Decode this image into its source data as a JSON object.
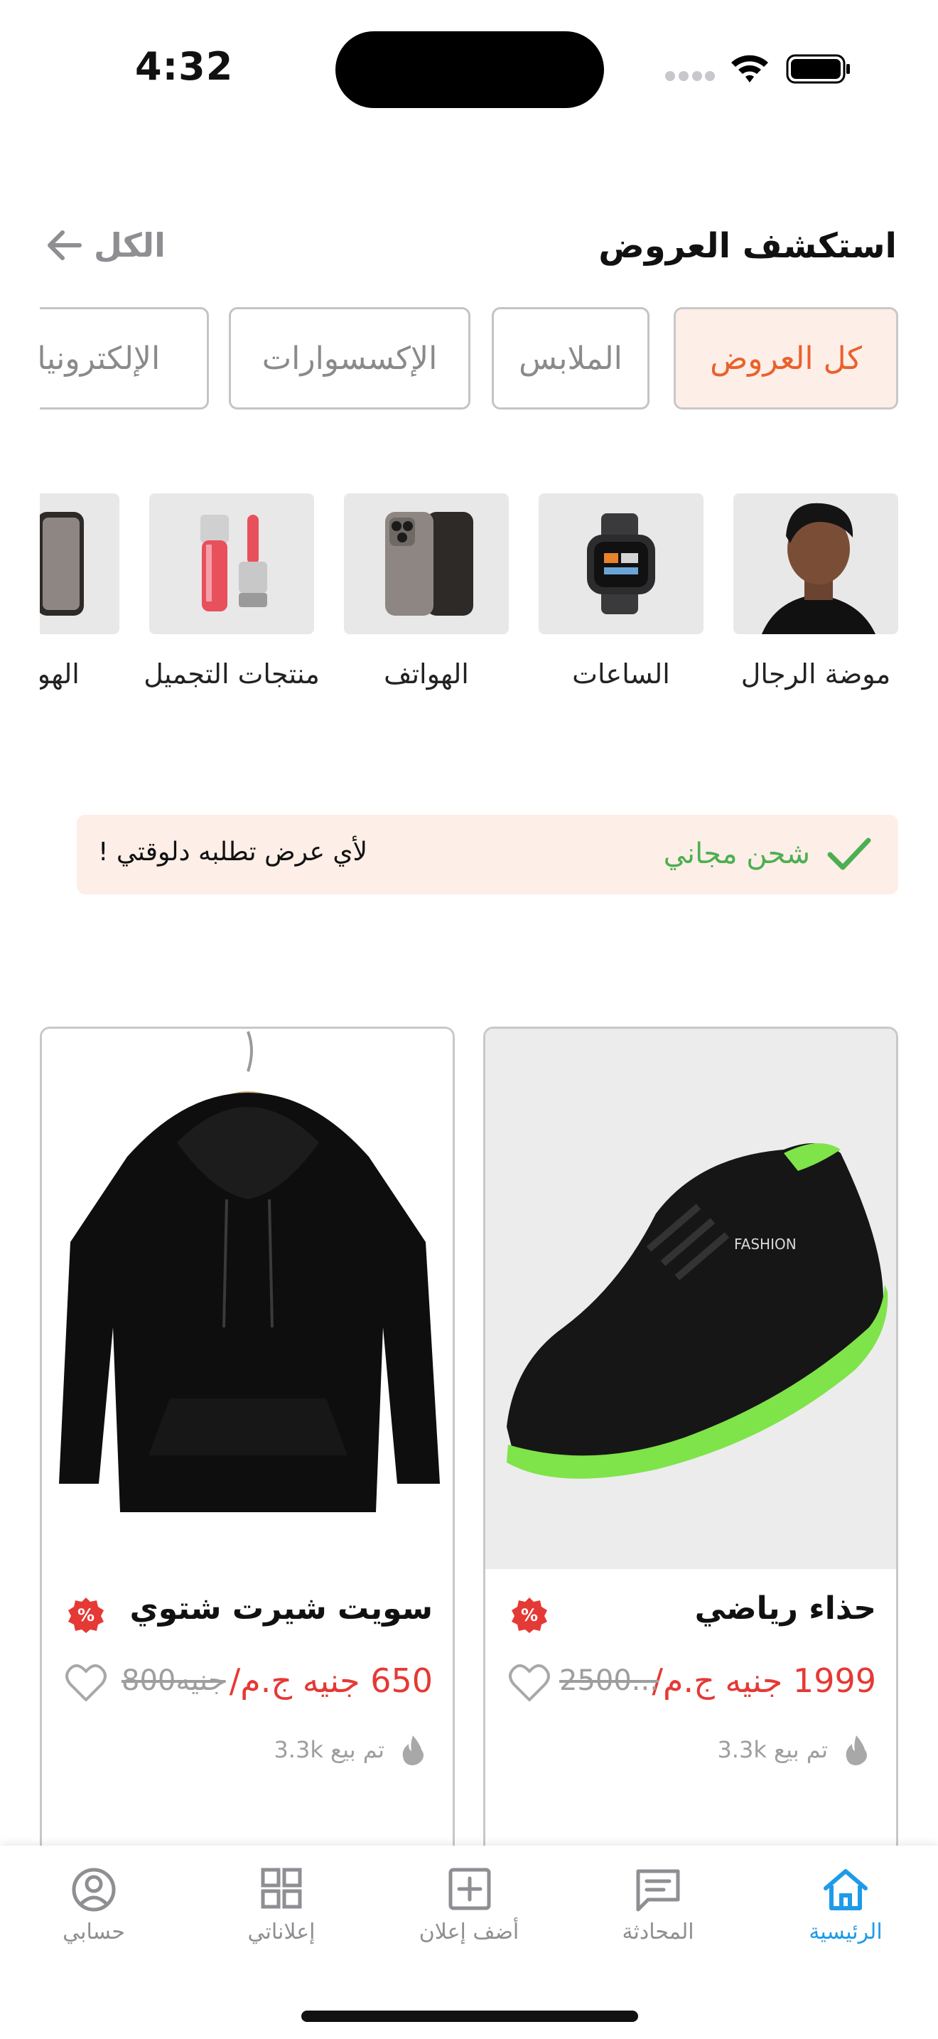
{
  "status_bar": {
    "time": "4:32"
  },
  "header": {
    "title": "استكشف العروض",
    "see_all": "الكل"
  },
  "tabs": [
    {
      "label": "كل العروض",
      "active": true
    },
    {
      "label": "الملابس",
      "active": false
    },
    {
      "label": "الإكسسوارات",
      "active": false
    },
    {
      "label": "الإلكترونيات",
      "active": false
    }
  ],
  "categories": [
    {
      "label": "موضة الرجال",
      "image": "man-portrait"
    },
    {
      "label": "الساعات",
      "image": "smartwatch"
    },
    {
      "label": "الهواتف",
      "image": "smartphone"
    },
    {
      "label": "منتجات التجميل",
      "image": "lip-gloss"
    },
    {
      "label": "الهواتف",
      "image": "smartphone"
    }
  ],
  "banner": {
    "free_shipping": "شحن مجاني",
    "note": "لأي عرض تطلبه دلوقتي !"
  },
  "products": [
    {
      "title": "حذاء رياضي",
      "price": "1999 جنيه ج.م/",
      "old_price": "2500...",
      "sold": "تم بيع 3.3k",
      "image": "sneaker"
    },
    {
      "title": "سويت شيرت شتوي",
      "price": "650 جنيه ج.م/",
      "old_price": "800جنيه",
      "sold": "تم بيع 3.3k",
      "image": "hoodie"
    }
  ],
  "nav": [
    {
      "label": "الرئيسية",
      "icon": "home-icon",
      "active": true
    },
    {
      "label": "المحادثة",
      "icon": "chat-icon",
      "active": false
    },
    {
      "label": "أضف إعلان",
      "icon": "add-icon",
      "active": false
    },
    {
      "label": "إعلاناتي",
      "icon": "grid-icon",
      "active": false
    },
    {
      "label": "حسابي",
      "icon": "profile-icon",
      "active": false
    }
  ],
  "colors": {
    "accent": "#e8622c",
    "price": "#e53935",
    "success": "#4caf50",
    "nav_active": "#1e9be8",
    "tab_active_bg": "#fdeee8"
  }
}
